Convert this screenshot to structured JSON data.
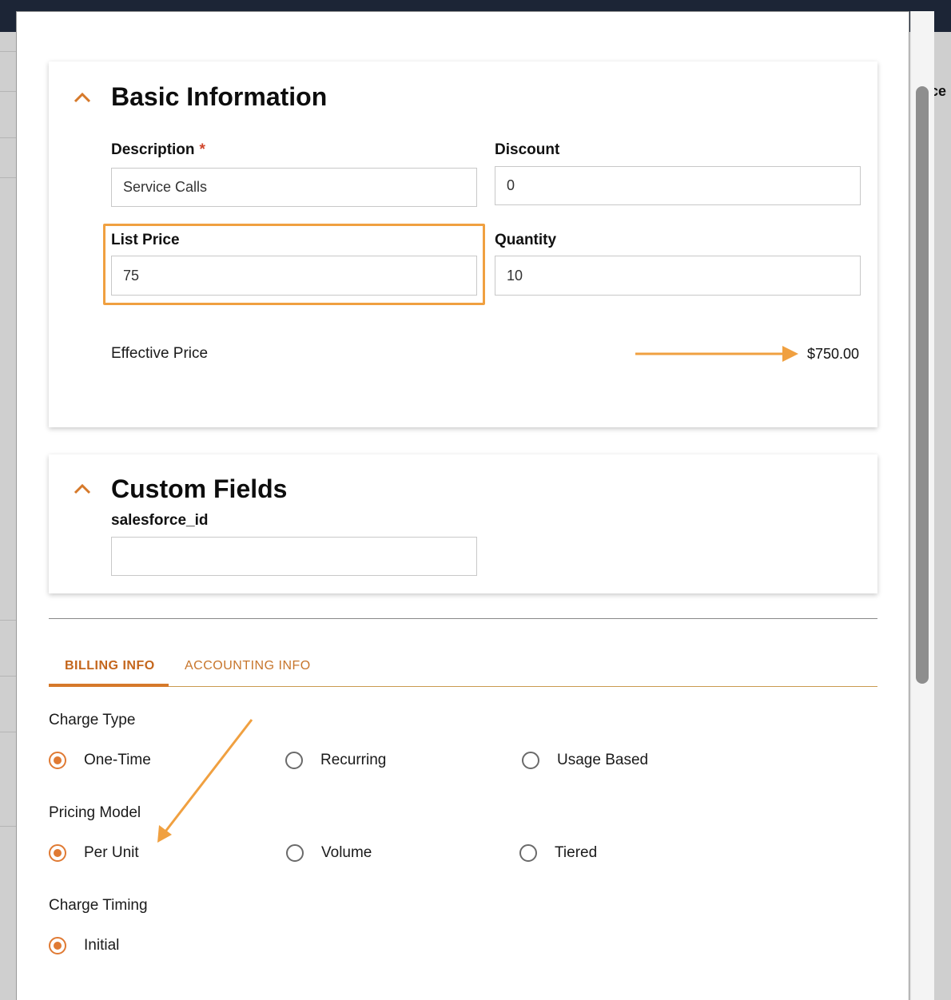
{
  "background": {
    "peek_text": "ce"
  },
  "basic_info": {
    "title": "Basic Information",
    "description": {
      "label": "Description",
      "required_mark": "*",
      "value": "Service Calls"
    },
    "discount": {
      "label": "Discount",
      "value": "0"
    },
    "list_price": {
      "label": "List Price",
      "value": "75"
    },
    "quantity": {
      "label": "Quantity",
      "value": "10"
    },
    "effective_price": {
      "label": "Effective Price",
      "value": "$750.00"
    }
  },
  "custom_fields": {
    "title": "Custom Fields",
    "salesforce_id": {
      "label": "salesforce_id",
      "value": ""
    }
  },
  "tabs": [
    {
      "label": "BILLING INFO",
      "active": true
    },
    {
      "label": "ACCOUNTING INFO",
      "active": false
    }
  ],
  "billing": {
    "charge_type": {
      "label": "Charge Type",
      "options": [
        "One-Time",
        "Recurring",
        "Usage Based"
      ],
      "selected": "One-Time"
    },
    "pricing_model": {
      "label": "Pricing Model",
      "options": [
        "Per Unit",
        "Volume",
        "Tiered"
      ],
      "selected": "Per Unit"
    },
    "charge_timing": {
      "label": "Charge Timing",
      "options": [
        "Initial"
      ],
      "selected": "Initial"
    }
  },
  "colors": {
    "accent": "#e07a33",
    "annotation": "#f0a040"
  }
}
